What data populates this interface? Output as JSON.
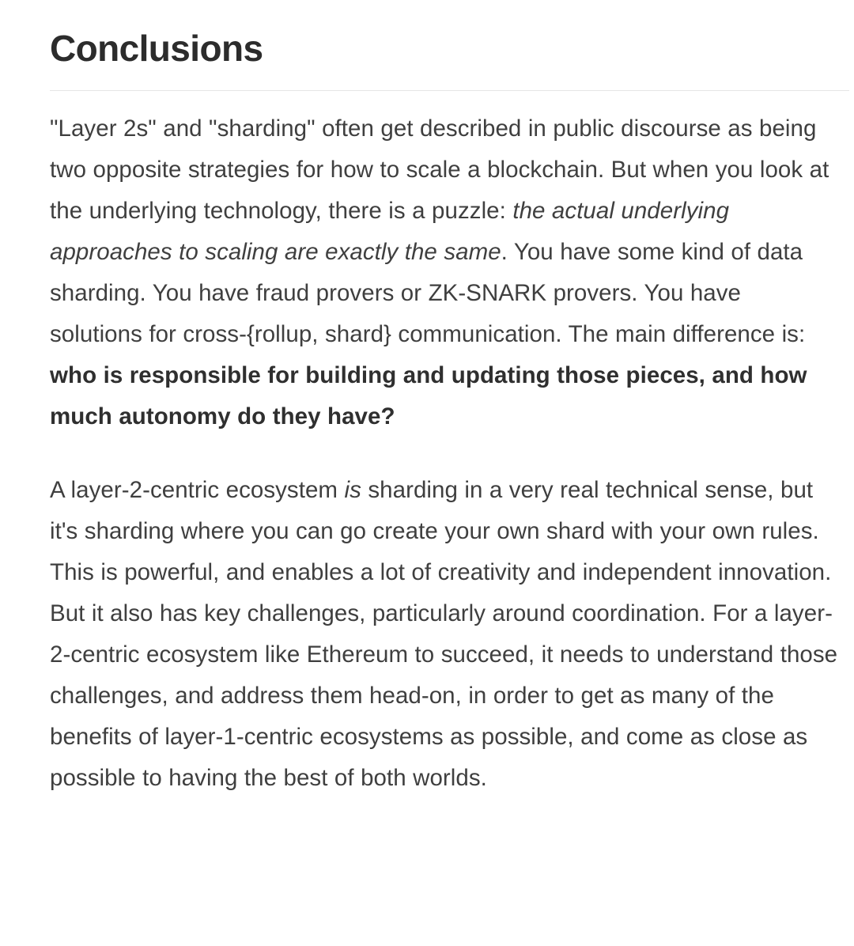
{
  "document": {
    "heading": "Conclusions",
    "paragraphs": [
      {
        "id": "paragraph-1",
        "segments": [
          {
            "style": "normal",
            "text": "\"Layer 2s\" and \"sharding\" often get described in public discourse as being two opposite strategies for how to scale a blockchain. But when you look at the underlying technology, there is a puzzle: "
          },
          {
            "style": "italic",
            "text": "the actual underlying approaches to scaling are exactly the same"
          },
          {
            "style": "normal",
            "text": ". You have some kind of data sharding. You have fraud provers or ZK-SNARK provers. You have solutions for cross-{rollup, shard} communication. The main difference is: "
          },
          {
            "style": "bold",
            "text": "who is responsible for building and updating those pieces, and how much autonomy do they have?"
          }
        ]
      },
      {
        "id": "paragraph-2",
        "segments": [
          {
            "style": "normal",
            "text": "A layer-2-centric ecosystem "
          },
          {
            "style": "italic",
            "text": "is"
          },
          {
            "style": "normal",
            "text": " sharding in a very real technical sense, but it's sharding where you can go create your own shard with your own rules. This is powerful, and enables a lot of creativity and independent innovation. But it also has key challenges, particularly around coordination. For a layer-2-centric ecosystem like Ethereum to succeed, it needs to understand those challenges, and address them head-on, in order to get as many of the benefits of layer-1-centric ecosystems as possible, and come as close as possible to having the best of both worlds."
          }
        ]
      }
    ],
    "colors": {
      "heading": "#2c2c2c",
      "body": "#3f3f3f",
      "strong": "#2f2f2f",
      "rule": "#e6e6e6",
      "background": "#ffffff"
    }
  }
}
